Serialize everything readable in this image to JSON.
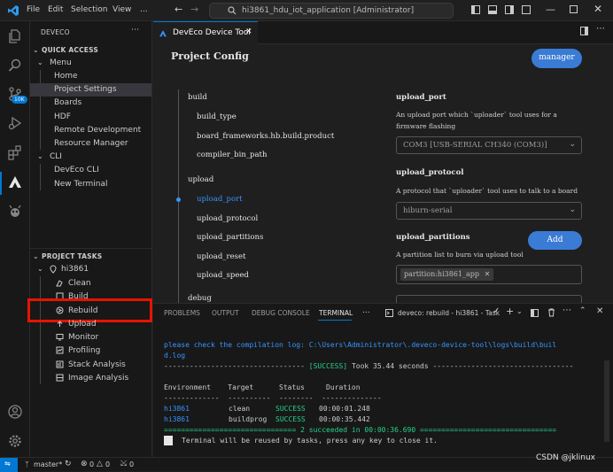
{
  "titlebar": {
    "menus": [
      "File",
      "Edit",
      "Selection",
      "View",
      "..."
    ],
    "search": "hi3861_hdu_iot_application [Administrator]"
  },
  "sidebar": {
    "title": "DEVECO",
    "quick_access": "QUICK ACCESS",
    "menu_group": "Menu",
    "menu_items": [
      "Home",
      "Project Settings",
      "Boards",
      "HDF",
      "Remote Development",
      "Resource Manager"
    ],
    "cli_group": "CLI",
    "cli_items": [
      "DevEco CLI",
      "New Terminal"
    ],
    "project_tasks": "PROJECT TASKS",
    "project": "hi3861",
    "tasks": [
      "Clean",
      "Build",
      "Rebuild",
      "Upload",
      "Monitor",
      "Profiling",
      "Stack Analysis",
      "Image Analysis"
    ]
  },
  "editor": {
    "tab_label": "DevEco Device Tool",
    "heading": "Project Config",
    "manager_button": "manager",
    "nav": {
      "build": "build",
      "build_items": [
        "build_type",
        "board_frameworks.hb.build.product",
        "compiler_bin_path"
      ],
      "upload": "upload",
      "upload_items": [
        "upload_port",
        "upload_protocol",
        "upload_partitions",
        "upload_reset",
        "upload_speed"
      ],
      "debug": "debug"
    },
    "upload_port": {
      "title": "upload_port",
      "desc": "An upload port which `uploader` tool uses for a firmware flashing",
      "value": "COM3 [USB-SERIAL CH340 (COM3)]"
    },
    "upload_protocol": {
      "title": "upload_protocol",
      "desc": "A protocol that `uploader` tool uses to talk to a board",
      "value": "hiburn-serial"
    },
    "upload_partitions": {
      "title": "upload_partitions",
      "add_button": "Add",
      "desc": "A partition list to burn via upload tool",
      "tag": "partition:hi3861_app"
    }
  },
  "panel": {
    "tabs": [
      "PROBLEMS",
      "OUTPUT",
      "DEBUG CONSOLE",
      "TERMINAL",
      "..."
    ],
    "task_label": "deveco: rebuild - hi3861 - Task",
    "log_line1": "please check the compilation log: C:\\Users\\Administrator\\.deveco-device-tool\\logs\\build\\buil",
    "log_line2": "d.log",
    "success_left": "--------------------------------- ",
    "success_tag": "[SUCCESS]",
    "success_right": " Took 35.44 seconds ---------------------------------",
    "table_header": "Environment    Target      Status     Duration",
    "table_sep": "-------------  ----------  --------  --------------",
    "rows": [
      {
        "env": "hi3861",
        "target": "clean",
        "status": "SUCCESS",
        "duration": "00:00:01.248"
      },
      {
        "env": "hi3861",
        "target": "buildprog",
        "status": "SUCCESS",
        "duration": "00:00:35.442"
      }
    ],
    "summary": "=============================== 2 succeeded in 00:00:36.690 ================================",
    "reuse_note": "Terminal will be reused by tasks, press any key to close it."
  },
  "status": {
    "branch": "master*",
    "problems": "0",
    "warnings": "0",
    "ports": "0",
    "watermark": "CSDN @jklinux"
  },
  "colors": {
    "accent": "#0078d4",
    "button": "#3a7bd5",
    "terminal_blue": "#3794ff",
    "terminal_green": "#23d18b",
    "highlight_box": "#e51400"
  }
}
